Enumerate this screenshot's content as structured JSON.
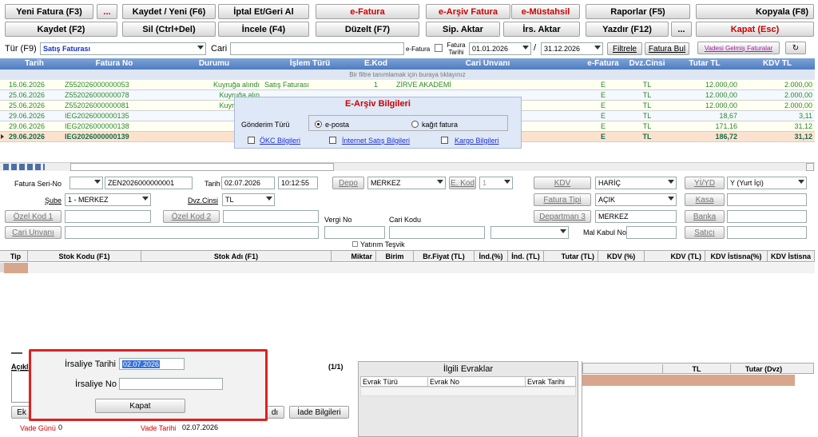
{
  "toolbar": {
    "row1": [
      "Yeni Fatura (F3)",
      "...",
      "Kaydet / Yeni (F6)",
      "İptal Et/Geri Al",
      "e-Fatura",
      "e-Arşiv Fatura",
      "e-Müstahsil",
      "Raporlar (F5)",
      "Kopyala (F8)"
    ],
    "row2": [
      "Kaydet (F2)",
      "Sil (Ctrl+Del)",
      "İncele (F4)",
      "Düzelt (F7)",
      "Sip. Aktar",
      "İrs. Aktar",
      "Yazdır (F12)",
      "...",
      "Kapat (Esc)"
    ]
  },
  "filter": {
    "tur_label": "Tür (F9)",
    "tur_value": "Satış Faturası",
    "cari_label": "Cari",
    "efatura_label": "e-Fatura",
    "fatura_tarihi_label": "Fatura Tarihi",
    "date_from": "01.01.2026",
    "date_to": "31.12.2026",
    "slash": "/",
    "filtrele": "Filtrele",
    "fatura_bul": "Fatura Bul",
    "vadesi": "Vadesi Gelmiş Faturalar",
    "refresh_glyph": "↻"
  },
  "grid": {
    "headers": [
      "Tarih",
      "Fatura No",
      "Durumu",
      "İşlem Türü",
      "E.Kod",
      "Cari Unvanı",
      "e-Fatura",
      "Dvz.Cinsi",
      "Tutar TL",
      "KDV TL"
    ],
    "hint": "Bir filtre tanımlamak için buraya tıklayınız",
    "rows": [
      [
        "16.06.2026",
        "Z552026000000053",
        "Kuyruğa alındı",
        "Satış Faturası",
        "1",
        "ZİRVE AKADEMİ",
        "E",
        "TL",
        "12.000,00",
        "2.000,00"
      ],
      [
        "25.06.2026",
        "Z552026000000078",
        "Kuyruğa alın",
        "",
        "",
        "",
        "E",
        "TL",
        "12.000,00",
        "2.000,00"
      ],
      [
        "25.06.2026",
        "Z552026000000081",
        "Kuyruğa alın",
        "",
        "",
        "",
        "E",
        "TL",
        "12.000,00",
        "2.000,00"
      ],
      [
        "29.06.2026",
        "IEG2026000000135",
        "",
        "",
        "",
        "",
        "E",
        "TL",
        "18,67",
        "3,11"
      ],
      [
        "29.06.2026",
        "IEG2026000000138",
        "",
        "",
        "",
        "",
        "E",
        "TL",
        "171,16",
        "31,12"
      ],
      [
        "29.06.2026",
        "IEG2026000000139",
        "",
        "",
        "",
        "",
        "E",
        "TL",
        "186,72",
        "31,12"
      ]
    ]
  },
  "earsiv": {
    "title": "E-Arşiv Bilgileri",
    "gonderim": "Gönderim Türü",
    "eposta": "e-posta",
    "kagit": "kağıt fatura",
    "okc": "ÖKC Bilgileri",
    "internet": "İnternet Satış Bilgileri",
    "kargo": "Kargo Bilgileri"
  },
  "form": {
    "seri_label": "Fatura Seri-No",
    "seri_no": "ZEN2026000000001",
    "tarih_label": "Tarih",
    "tarih": "02.07.2026",
    "saat": "10:12:55",
    "depo_btn": "Depo",
    "depo": "MERKEZ",
    "ekod_btn": "E. Kod",
    "ekod": "1",
    "kdv_btn": "KDV",
    "kdv": "HARİÇ",
    "yiyd_btn": "Yİ/YD",
    "yiyd": "Y (Yurt İçi)",
    "sube_label": "Şube",
    "sube": "1 - MERKEZ",
    "dvz_label": "Dvz.Cinsi",
    "dvz": "TL",
    "fatura_tipi_btn": "Fatura Tipi",
    "fatura_tipi": "AÇIK",
    "kasa_btn": "Kasa",
    "ozel1": "Özel Kod 1",
    "ozel2": "Özel Kod 2",
    "departman_btn": "Departman 3",
    "departman": "MERKEZ",
    "banka_btn": "Banka",
    "vergi_no": "Vergi No",
    "cari_kodu": "Cari Kodu",
    "cari_unvani": "Cari Unvanı",
    "mal_kabul": "Mal Kabul No",
    "satici": "Satıcı",
    "yatirim": "Yatırım Teşvik"
  },
  "items": {
    "headers": [
      "Tip",
      "Stok Kodu (F1)",
      "Stok Adı (F1)",
      "Miktar",
      "Birim",
      "Br.Fiyat (TL)",
      "İnd.(%)",
      "İnd. (TL)",
      "Tutar (TL)",
      "KDV (%)",
      "KDV (TL)",
      "KDV İstisna(%)",
      "KDV İstisna"
    ]
  },
  "bottom": {
    "aciklama": "Açıkl",
    "page": "(1/1)",
    "ilgili": "İlgili Evraklar",
    "evrak_cols": [
      "Evrak Türü",
      "Evrak No",
      "Evrak Tarihi"
    ],
    "tl_cols": [
      "TL",
      "Tutar (Dvz)"
    ],
    "ek": "Ek",
    "di": "dı",
    "irade": "İade Bilgileri",
    "vade_gunu_label": "Vade Günü",
    "vade_gunu": "0",
    "vade_tarihi_label": "Vade Tarihi",
    "vade_tarihi": "02.07.2026"
  },
  "irsaliye": {
    "tarih_label": "İrsaliye Tarihi",
    "tarih": "02.07.2026",
    "no_label": "İrsaliye No",
    "no": "",
    "kapat": "Kapat"
  }
}
